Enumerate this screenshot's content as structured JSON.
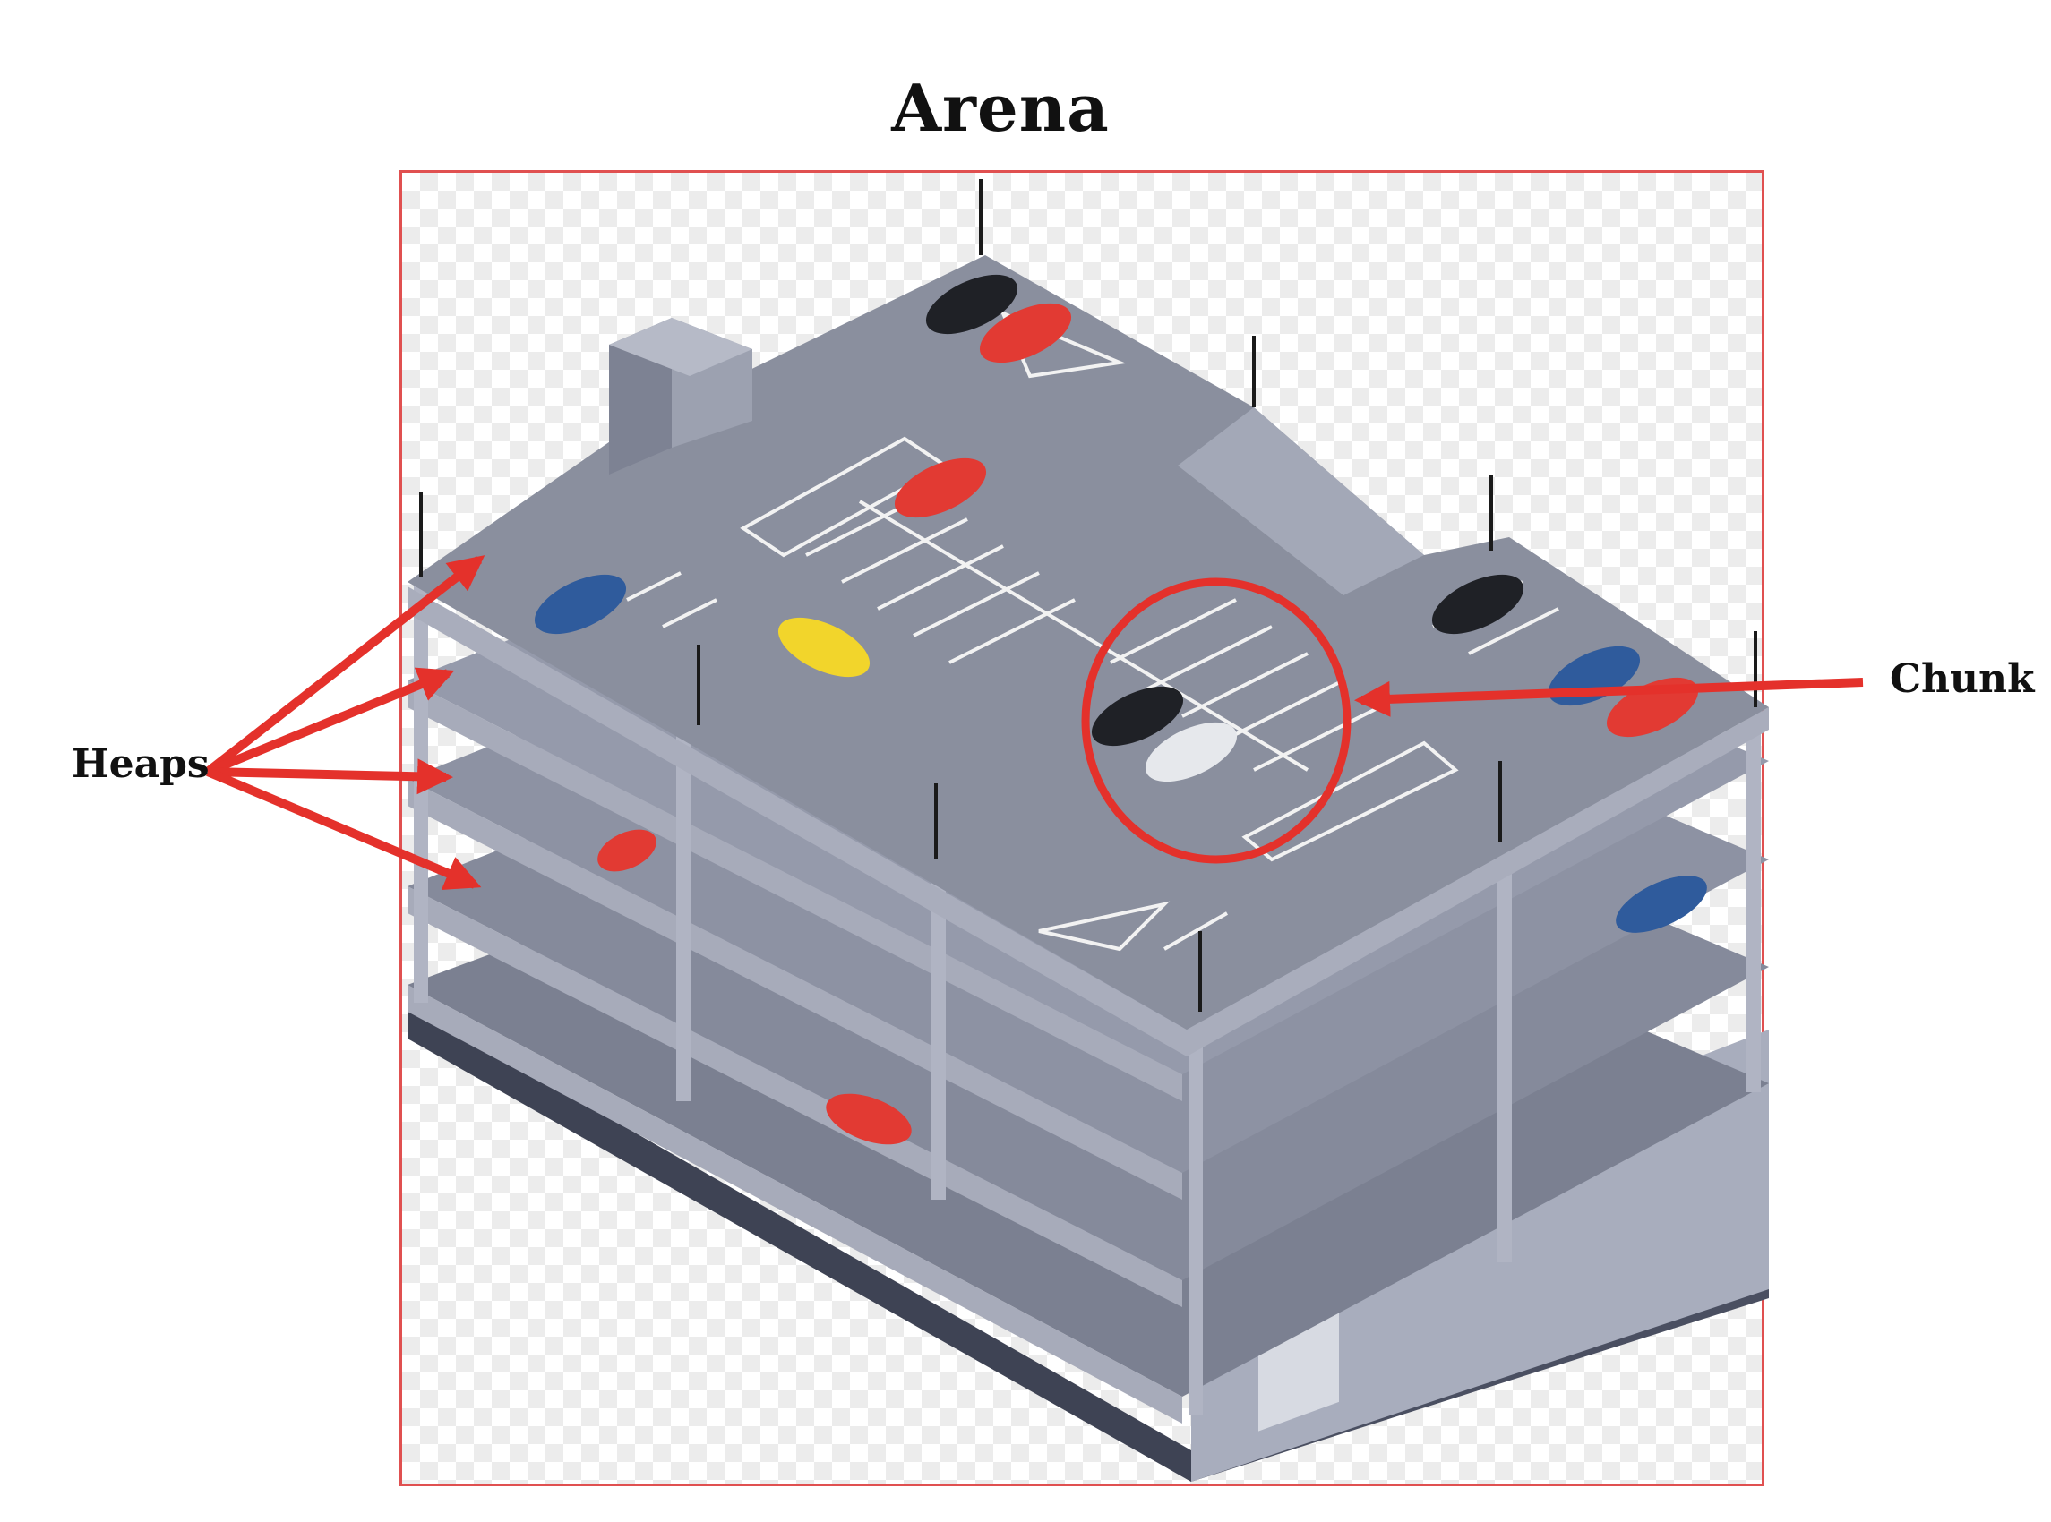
{
  "diagram": {
    "title": "Arena",
    "labels": {
      "heaps": "Heaps",
      "chunk": "Chunk"
    },
    "colors": {
      "annotation": "#e4312b",
      "frame": "#e05050",
      "deck": "#8a8f9e",
      "deck_side": "#6d7282",
      "structure": "#9ea3b3",
      "shadow": "#4a4f61",
      "car_red": "#e23a33",
      "car_blue": "#2f5b9c",
      "car_black": "#1f2126",
      "car_yellow": "#f2d52b",
      "car_white": "#e6e8ec"
    }
  }
}
